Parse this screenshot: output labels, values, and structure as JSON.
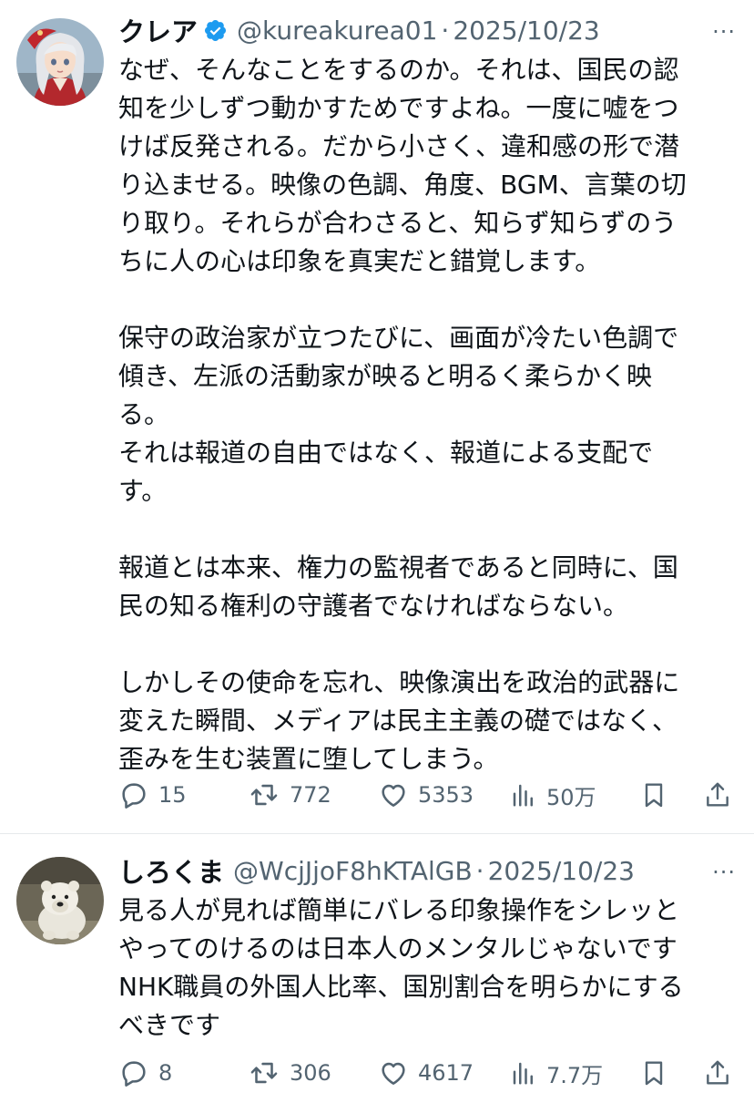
{
  "tweets": [
    {
      "name": "クレア",
      "handle": "@kureakurea01",
      "sep": "·",
      "date": "2025/10/23",
      "more": "···",
      "verified": true,
      "avatar_icon": "avatar-anime-girl-icon",
      "lines": [
        "なぜ、そんなことをするのか。それは、国民の認",
        "知を少しずつ動かすためですよね。一度に嘘をつ",
        "けば反発される。だから小さく、違和感の形で潜",
        "り込ませる。映像の色調、角度、BGM、言葉の切",
        "り取り。それらが合わさると、知らず知らずのう",
        "ちに人の心は印象を真実だと錯覚します。",
        "",
        "保守の政治家が立つたびに、画面が冷たい色調で",
        "傾き、左派の活動家が映ると明るく柔らかく映",
        "る。",
        "それは報道の自由ではなく、報道による支配で",
        "す。",
        "",
        "報道とは本来、権力の監視者であると同時に、国",
        "民の知る権利の守護者でなければならない。",
        "",
        "しかしその使命を忘れ、映像演出を政治的武器に",
        "変えた瞬間、メディアは民主主義の礎ではなく、",
        "歪みを生む装置に堕してしまう。"
      ],
      "actions": {
        "replies": "15",
        "reposts": "772",
        "likes": "5353",
        "views": "50万"
      }
    },
    {
      "name": "しろくま",
      "handle": "@WcjJjoF8hKTAlGB",
      "sep": "·",
      "date": "2025/10/23",
      "more": "···",
      "verified": false,
      "avatar_icon": "avatar-polar-bear-icon",
      "lines": [
        "見る人が見れば簡単にバレる印象操作をシレッと",
        "やってのけるのは日本人のメンタルじゃないです",
        "NHK職員の外国人比率、国別割合を明らかにする",
        "べきです"
      ],
      "actions": {
        "replies": "8",
        "reposts": "306",
        "likes": "4617",
        "views": "7.7万"
      }
    }
  ],
  "colors": {
    "text": "#0f1419",
    "muted": "#536471",
    "verified": "#1d9bf0",
    "divider": "#e6e9ec"
  }
}
